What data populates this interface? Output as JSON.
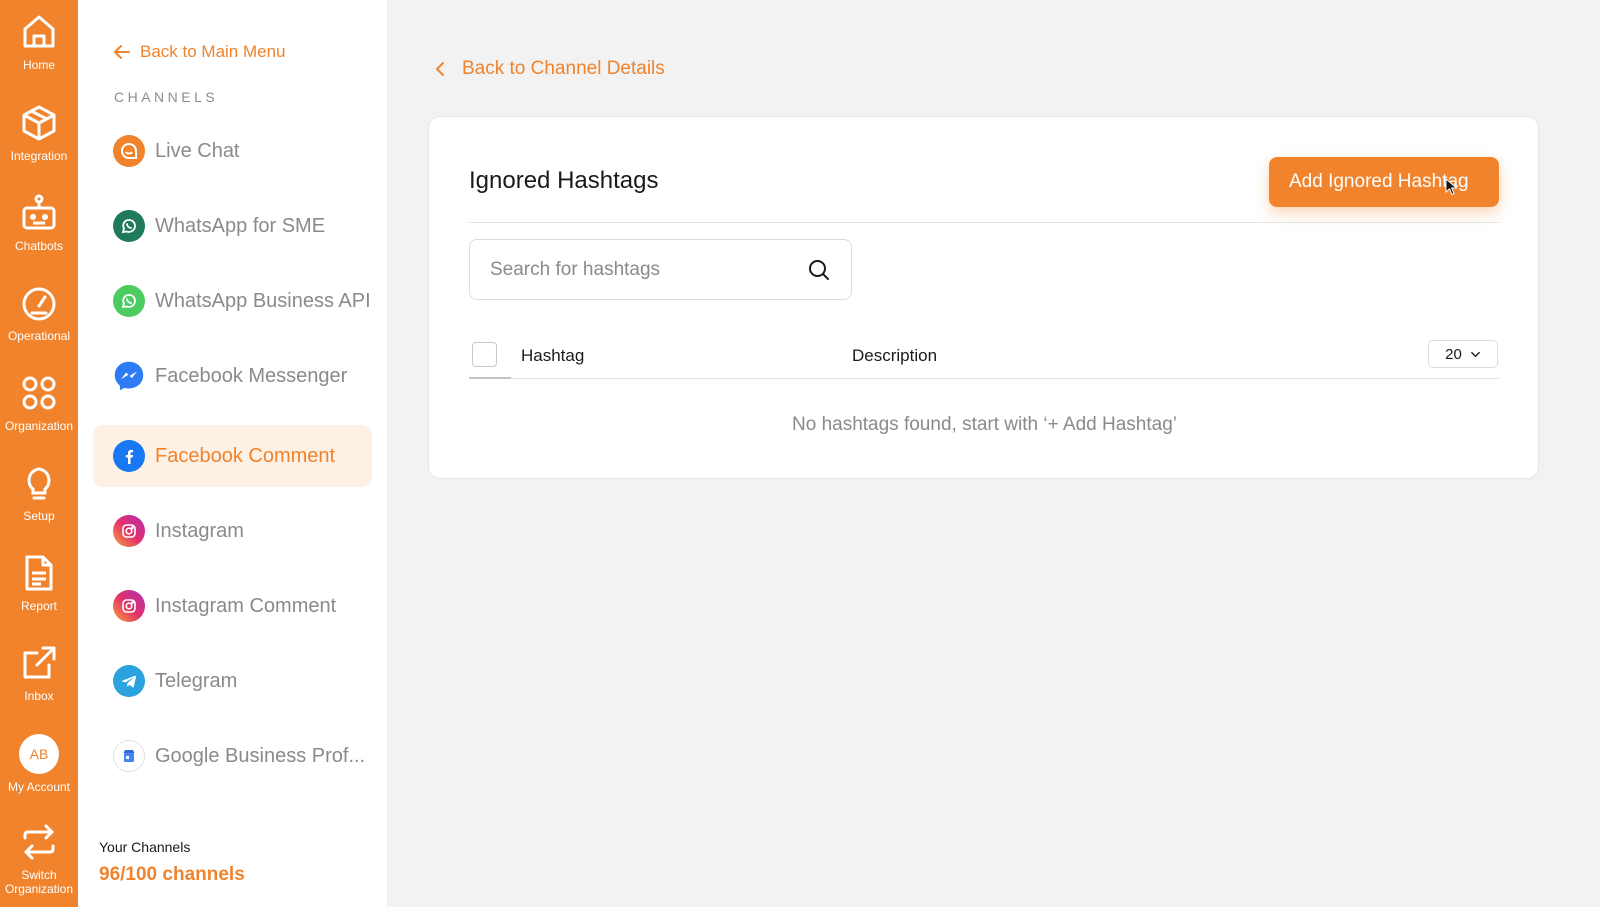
{
  "rail": {
    "home": "Home",
    "integration": "Integration",
    "chatbots": "Chatbots",
    "operational": "Operational",
    "organization": "Organization",
    "setup": "Setup",
    "report": "Report",
    "inbox": "Inbox",
    "avatar_initials": "AB",
    "my_account": "My Account",
    "switch_org_line1": "Switch",
    "switch_org_line2": "Organization"
  },
  "sidebar": {
    "back_label": "Back to Main Menu",
    "section_title": "CHANNELS",
    "channels": [
      {
        "label": "Live Chat",
        "icon": "live-chat-icon",
        "color": "#f0832c"
      },
      {
        "label": "WhatsApp for SME",
        "icon": "whatsapp-icon",
        "color": "#1f7a5a"
      },
      {
        "label": "WhatsApp Business API",
        "icon": "whatsapp-icon",
        "color": "#4ccb60"
      },
      {
        "label": "Facebook Messenger",
        "icon": "messenger-icon",
        "color": "#2d7cf6"
      },
      {
        "label": "Facebook Comment",
        "icon": "facebook-icon",
        "color": "#1877f2",
        "active": true
      },
      {
        "label": "Instagram",
        "icon": "instagram-icon",
        "color": "#e1306c"
      },
      {
        "label": "Instagram Comment",
        "icon": "instagram-icon",
        "color": "#e1306c"
      },
      {
        "label": "Telegram",
        "icon": "telegram-icon",
        "color": "#2aa3de"
      },
      {
        "label": "Google Business Prof...",
        "icon": "google-business-icon",
        "color": "#4285f4"
      }
    ],
    "your_channels_label": "Your Channels",
    "channel_count": "96/100 channels"
  },
  "main": {
    "back_label": "Back to Channel Details",
    "card": {
      "title": "Ignored Hashtags",
      "add_button": "Add Ignored Hashtag",
      "search_placeholder": "Search for hashtags",
      "columns": [
        "Hashtag",
        "Description"
      ],
      "page_size": "20",
      "empty_message": "No hashtags found, start with ‘+ Add Hashtag’"
    }
  },
  "colors": {
    "accent": "#f0832c",
    "active_bg": "#fdf1e6",
    "page_bg": "#f2f2f2"
  }
}
